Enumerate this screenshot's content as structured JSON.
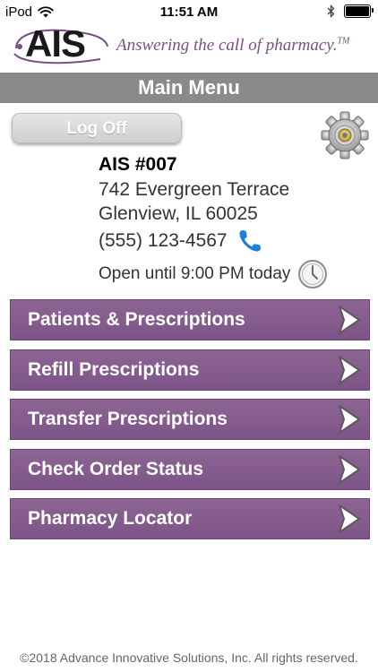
{
  "status_bar": {
    "carrier": "iPod",
    "time": "11:51 AM",
    "icons": [
      "wifi-icon",
      "bluetooth-icon",
      "battery-icon"
    ],
    "battery_level": 1.0
  },
  "logo": {
    "brand": "AIS",
    "tagline": "Answering the call of pharmacy.",
    "trademark": "TM",
    "color": "#7c4e86"
  },
  "header": {
    "title": "Main Menu"
  },
  "toolbar": {
    "logoff_label": "Log Off",
    "settings_icon": "gear-icon"
  },
  "store": {
    "name": "AIS #007",
    "address_line1": "742 Evergreen Terrace",
    "address_line2": "Glenview, IL 60025",
    "phone": "(555) 123-4567",
    "phone_icon": "phone-icon",
    "hours": "Open until 9:00 PM today",
    "hours_icon": "clock-icon"
  },
  "menu": {
    "items": [
      {
        "label": "Patients & Prescriptions"
      },
      {
        "label": "Refill Prescriptions"
      },
      {
        "label": "Transfer Prescriptions"
      },
      {
        "label": "Check Order Status"
      },
      {
        "label": "Pharmacy Locator"
      }
    ],
    "chevron_icon": "chevron-right-icon"
  },
  "colors": {
    "accent": "#7d5487",
    "title_bar": "#8a8a8a",
    "phone_icon": "#1e7de0"
  },
  "footer": {
    "copyright": "©2018 Advance Innovative Solutions, Inc. All rights reserved."
  }
}
